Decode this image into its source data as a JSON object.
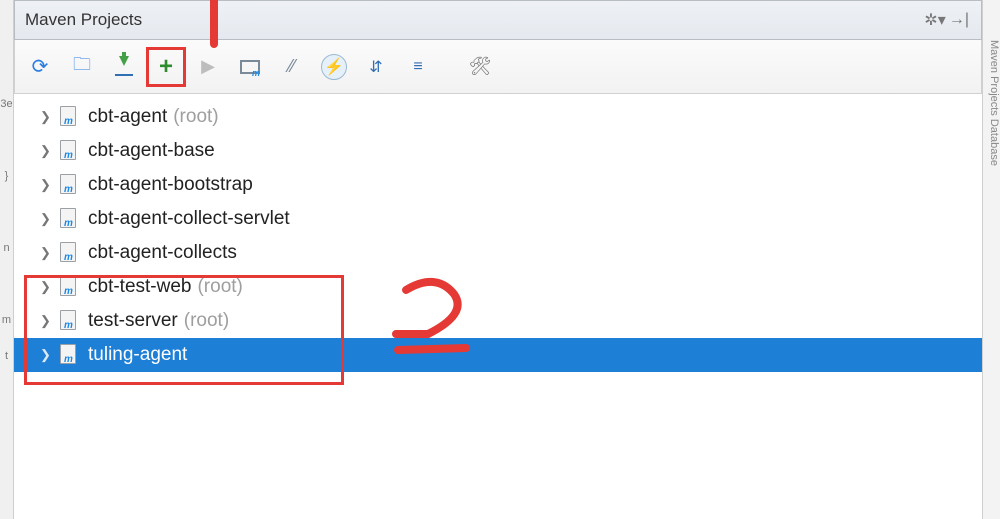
{
  "panel": {
    "title": "Maven Projects"
  },
  "toolbar": {
    "refresh": "Reimport",
    "generate": "Generate Sources",
    "download": "Download Sources",
    "add": "Add Maven Projects",
    "run": "Run",
    "execute": "Execute Goal",
    "skip": "Toggle Skip Tests",
    "offline": "Toggle Offline",
    "collapse": "Collapse All",
    "expand": "Expand All",
    "settings": "Maven Settings"
  },
  "tree": [
    {
      "name": "cbt-agent",
      "suffix": "(root)",
      "selected": false
    },
    {
      "name": "cbt-agent-base",
      "suffix": "",
      "selected": false
    },
    {
      "name": "cbt-agent-bootstrap",
      "suffix": "",
      "selected": false
    },
    {
      "name": "cbt-agent-collect-servlet",
      "suffix": "",
      "selected": false
    },
    {
      "name": "cbt-agent-collects",
      "suffix": "",
      "selected": false
    },
    {
      "name": "cbt-test-web",
      "suffix": "(root)",
      "selected": false
    },
    {
      "name": "test-server",
      "suffix": "(root)",
      "selected": false
    },
    {
      "name": "tuling-agent",
      "suffix": "",
      "selected": true
    }
  ],
  "annotations": {
    "number": "2"
  },
  "rightTabs": "Maven Projects   Database"
}
